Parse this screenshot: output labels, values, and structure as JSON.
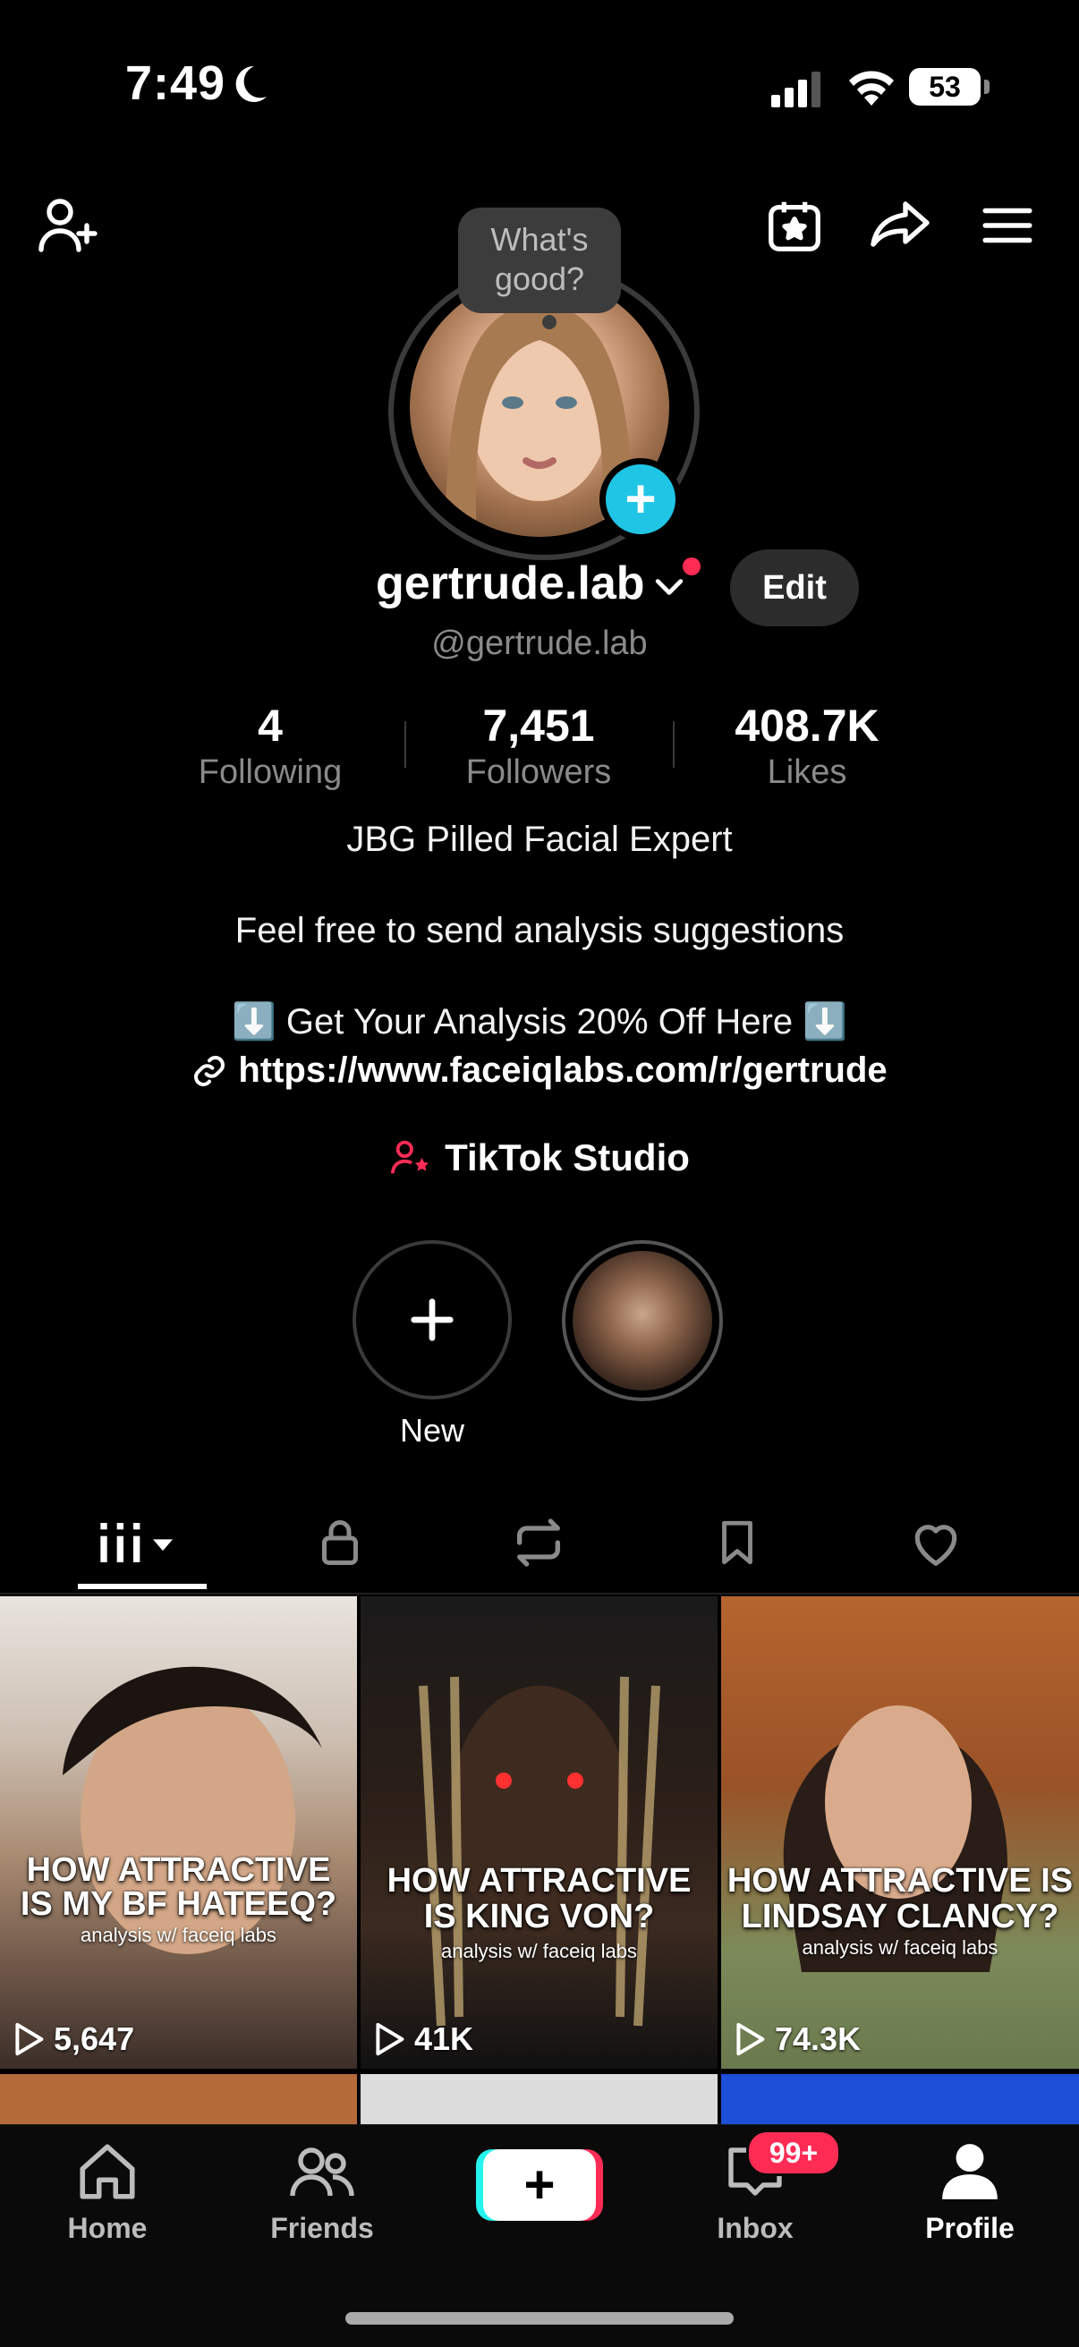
{
  "status_bar": {
    "time": "7:49",
    "battery": "53"
  },
  "bubble": {
    "line1": "What's",
    "line2": "good?"
  },
  "profile": {
    "username": "gertrude.lab",
    "edit_label": "Edit",
    "handle": "@gertrude.lab",
    "stats": [
      {
        "value": "4",
        "label": "Following"
      },
      {
        "value": "7,451",
        "label": "Followers"
      },
      {
        "value": "408.7K",
        "label": "Likes"
      }
    ],
    "bio_line1": "JBG Pilled Facial Expert",
    "bio_line2": "Feel free to send analysis suggestions",
    "bio_line3": "⬇️ Get Your Analysis 20% Off Here ⬇️",
    "link": "https://www.faceiqlabs.com/r/gertrude",
    "studio_label": "TikTok Studio"
  },
  "stories": {
    "new_label": "New"
  },
  "videos": [
    {
      "title1": "HOW ATTRACTIVE",
      "title2": "IS MY BF HATEEQ?",
      "sub": "analysis w/ faceiq labs",
      "views": "5,647"
    },
    {
      "title1": "HOW ATTRACTIVE",
      "title2": "IS KING VON?",
      "sub": "analysis w/ faceiq labs",
      "views": "41K"
    },
    {
      "title1": "HOW ATTRACTIVE IS",
      "title2": "LINDSAY CLANCY?",
      "sub": "analysis w/ faceiq labs",
      "views": "74.3K"
    }
  ],
  "nav": {
    "home": "Home",
    "friends": "Friends",
    "inbox": "Inbox",
    "inbox_badge": "99+",
    "profile": "Profile"
  },
  "colors": {
    "accent_cyan": "#20c5e6",
    "accent_red": "#fe2c55"
  }
}
